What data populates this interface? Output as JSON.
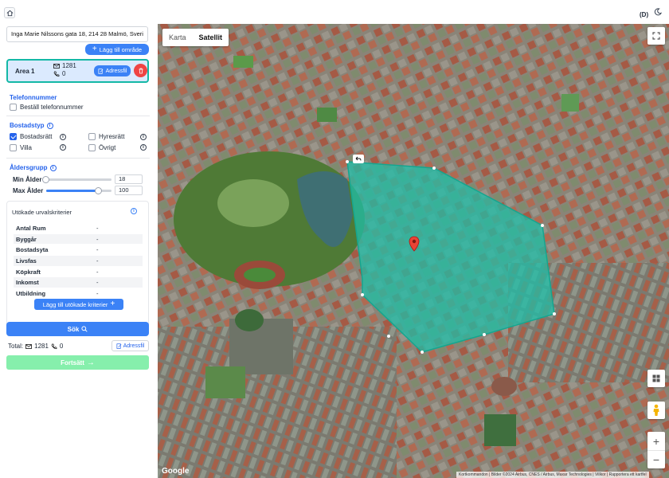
{
  "header": {
    "home_icon": "home-icon",
    "mode_label": "(D)",
    "theme_icon": "moon-icon"
  },
  "search": {
    "address_value": "Inga Marie Nilssons gata 18, 214 28 Malmö, Sveri"
  },
  "add_area_label": "Lägg till område",
  "area": {
    "name": "Area 1",
    "mail_count": "1281",
    "phone_count": "0",
    "adressfil_label": "Adressfil"
  },
  "telefon": {
    "title": "Telefonnummer",
    "order_label": "Beställ telefonnummer",
    "order_checked": false
  },
  "bostadstyp": {
    "title": "Bostadstyp",
    "options": [
      {
        "label": "Bostadsrätt",
        "checked": true
      },
      {
        "label": "Hyresrätt",
        "checked": false
      },
      {
        "label": "Villa",
        "checked": false
      },
      {
        "label": "Övrigt",
        "checked": false
      }
    ]
  },
  "alder": {
    "title": "Åldersgrupp",
    "min_label": "Min Ålder",
    "min_value": "18",
    "max_label": "Max Ålder",
    "max_value": "100"
  },
  "extended": {
    "title": "Utökade urvalskriterier",
    "rows": [
      {
        "key": "Antal Rum",
        "value": "-"
      },
      {
        "key": "Byggår",
        "value": "-"
      },
      {
        "key": "Bostadsyta",
        "value": "-"
      },
      {
        "key": "Livsfas",
        "value": "-"
      },
      {
        "key": "Köpkraft",
        "value": "-"
      },
      {
        "key": "Inkomst",
        "value": "-"
      },
      {
        "key": "Utbildning",
        "value": "-"
      }
    ],
    "add_label": "Lägg till utökade kriterier"
  },
  "search_button": "Sök",
  "total": {
    "label": "Total:",
    "mail": "1281",
    "phone": "0",
    "adressfil_label": "Adressfil"
  },
  "continue_label": "Fortsätt",
  "map": {
    "tab_map": "Karta",
    "tab_satellite": "Satellit",
    "active_tab": "Satellit",
    "brand": "Google",
    "attribution": "Kortkommandon | Bilder ©2024 Airbus, CNES / Airbus, Maxar Technologies | Villkor | Rapportera ett kartfel",
    "polygon_color": "#1fbfa8",
    "marker_color": "#ea4335"
  },
  "colors": {
    "accent": "#3b82f6",
    "danger": "#ef4444",
    "success": "#86efac",
    "title_blue": "#2563eb"
  }
}
